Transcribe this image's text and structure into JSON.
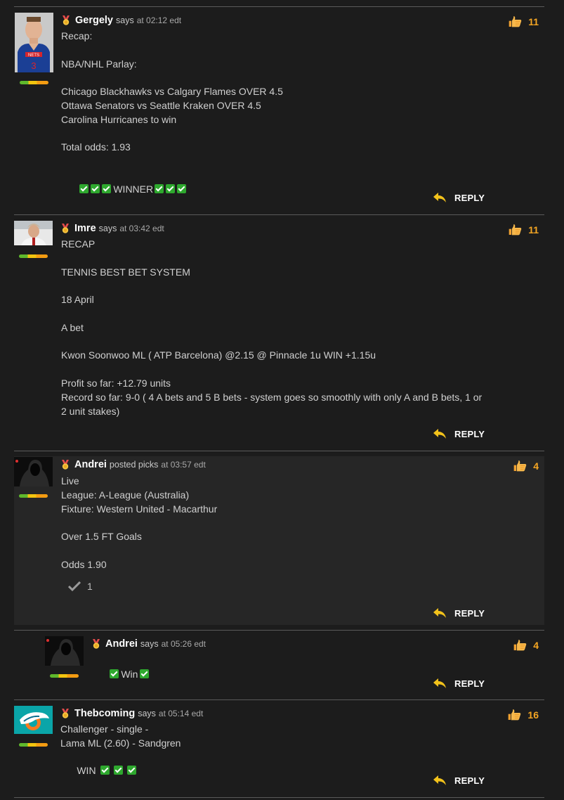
{
  "ui": {
    "reply_label": "REPLY"
  },
  "comments": [
    {
      "user": "Gergely",
      "verb": "says",
      "time": "at 02:12 edt",
      "likes": "11",
      "lines": [
        "Recap:",
        "",
        "NBA/NHL Parlay:",
        "",
        "Chicago Blackhawks vs Calgary Flames OVER 4.5",
        "Ottawa Senators vs Seattle Kraken OVER 4.5",
        "Carolina Hurricanes to win",
        "",
        "Total odds: 1.93",
        ""
      ],
      "result_word": "WINNER"
    },
    {
      "user": "Imre",
      "verb": "says",
      "time": "at 03:42 edt",
      "likes": "11",
      "lines": [
        "RECAP",
        "",
        "TENNIS BEST BET SYSTEM",
        "",
        "18 April",
        "",
        "A bet",
        "",
        "Kwon Soonwoo ML ( ATP Barcelona) @2.15 @ Pinnacle 1u WIN +1.15u",
        "",
        "Profit so far: +12.79 units",
        "Record so far: 9-0 ( 4 A bets and 5 B bets - system goes so smoothly with only A and B bets, 1 or",
        "2 unit stakes)"
      ]
    },
    {
      "user": "Andrei",
      "verb": "posted picks",
      "time": "at 03:57 edt",
      "likes": "4",
      "lines": [
        "Live",
        "League: A-League (Australia)",
        "Fixture: Western United - Macarthur",
        "",
        "Over 1.5 FT Goals",
        "",
        "Odds 1.90"
      ],
      "pick_count": "1"
    },
    {
      "user": "Andrei",
      "verb": "says",
      "time": "at 05:26 edt",
      "likes": "4",
      "result_word": "Win"
    },
    {
      "user": "Thebcoming",
      "verb": "says",
      "time": "at 05:14 edt",
      "likes": "16",
      "lines": [
        "Challenger - single -",
        "Lama ML (2.60) - Sandgren"
      ],
      "result_word": "WIN"
    }
  ],
  "icons": {
    "like": "thumbs-up-icon",
    "reply": "reply-arrow-icon",
    "medal": "medal-icon",
    "pick": "checkmark-icon",
    "win": "green-check-icon"
  },
  "colors": {
    "background": "#1c1c1c",
    "username": "#ffffff",
    "likes": "#f5a623",
    "win_check": "#2ea82e"
  }
}
